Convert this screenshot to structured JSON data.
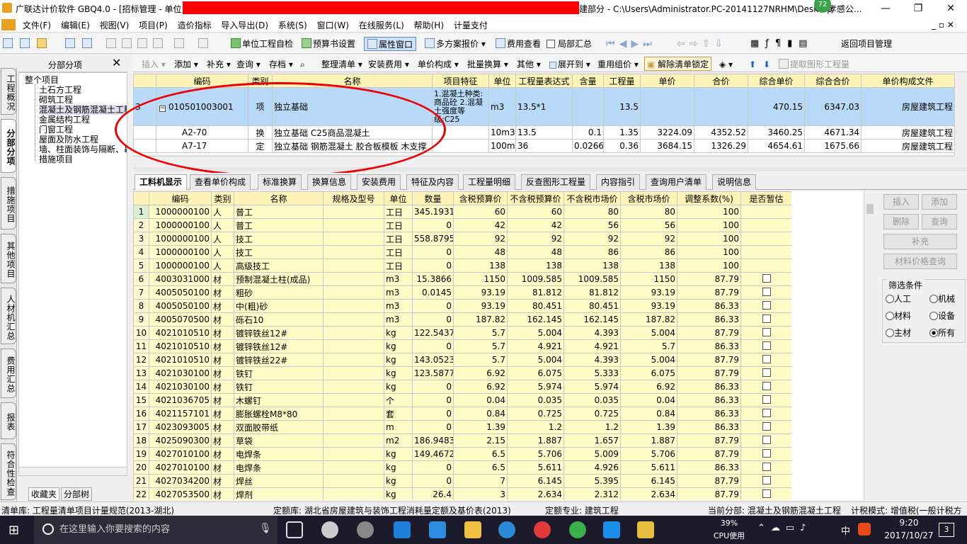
{
  "title": {
    "app": "广联达计价软件 GBQ4.0 - [招标管理 - 单位",
    "right": "建部分 - C:\\Users\\Administrator.PC-20141127NRHM\\Desktop",
    "right2": "孝感公...",
    "badge": "72"
  },
  "menu": [
    "文件(F)",
    "编辑(E)",
    "视图(V)",
    "项目(P)",
    "造价指标",
    "导入导出(D)",
    "系统(S)",
    "窗口(W)",
    "在线服务(L)",
    "帮助(H)",
    "计量支付"
  ],
  "toolbar1": [
    "单位工程自检",
    "预算书设置",
    "属性窗口",
    "多方案报价",
    "费用查看",
    "局部汇总",
    "返回项目管理"
  ],
  "toolbar2": [
    "插入",
    "添加",
    "补充",
    "查询",
    "存档",
    "整理清单",
    "安装费用",
    "单价构成",
    "批量换算",
    "其他",
    "展开到",
    "重用组价",
    "解除清单锁定",
    "提取图形工程量"
  ],
  "left_tabs": [
    "工程概况",
    "分部分项",
    "措施项目",
    "其他项目",
    "人材机汇总",
    "费用汇总",
    "报表",
    "符合性检查"
  ],
  "tree": {
    "header": "分部分项",
    "items": [
      "整个项目",
      "土石方工程",
      "砌筑工程",
      "混凝土及钢筋混凝土工程",
      "金属结构工程",
      "门窗工程",
      "屋面及防水工程",
      "墙、柱面装饰与隔断、幕",
      "措施项目"
    ],
    "bottom_tabs": [
      "收藏夹",
      "分部树"
    ]
  },
  "upper_grid": {
    "headers": [
      "编码",
      "类别",
      "名称",
      "项目特征",
      "单位",
      "工程量表达式",
      "含量",
      "工程量",
      "单价",
      "合价",
      "综合单价",
      "综合合价",
      "单价构成文件"
    ],
    "rows": [
      {
        "rn": "3",
        "code": "010501003001",
        "type": "项",
        "name": "独立基础",
        "feature": "1.混凝土种类:商品砼 2.混凝土强度等级:C25",
        "unit": "m3",
        "expr": "13.5*1",
        "content": "",
        "qty": "13.5",
        "price": "",
        "total": "",
        "uprice": "470.15",
        "utotal": "6347.03",
        "file": "房屋建筑工程"
      },
      {
        "rn": "",
        "code": "A2-70",
        "type": "换",
        "name": "独立基础 C25商品混凝土",
        "feature": "",
        "unit": "10m3",
        "expr": "13.5",
        "content": "0.1",
        "qty": "1.35",
        "price": "3224.09",
        "total": "4352.52",
        "uprice": "3460.25",
        "utotal": "4671.34",
        "file": "房屋建筑工程"
      },
      {
        "rn": "",
        "code": "A7-17",
        "type": "定",
        "name": "独立基础 钢筋混凝土 胶合板模板 木支撑",
        "feature": "",
        "unit": "100m2",
        "expr": "36",
        "content": "0.0266",
        "qty": "0.36",
        "price": "3684.15",
        "total": "1326.29",
        "uprice": "4654.61",
        "utotal": "1675.66",
        "file": "房屋建筑工程"
      }
    ]
  },
  "mid_tabs": [
    "工料机显示",
    "查看单价构成",
    "标准换算",
    "换算信息",
    "安装费用",
    "特征及内容",
    "工程量明细",
    "反查图形工程量",
    "内容指引",
    "查询用户清单",
    "说明信息"
  ],
  "lower_grid": {
    "headers": [
      "编码",
      "类别",
      "名称",
      "规格及型号",
      "单位",
      "数量",
      "含税预算价",
      "不含税预算价",
      "不含税市场价",
      "含税市场价",
      "调整系数(%)",
      "是否暂估"
    ],
    "rows": [
      [
        "1",
        "1000000100",
        "人",
        "普工",
        "",
        "工日",
        "345.1931",
        "60",
        "60",
        "80",
        "80",
        "100",
        ""
      ],
      [
        "2",
        "1000000100",
        "人",
        "普工",
        "",
        "工日",
        "0",
        "42",
        "42",
        "56",
        "56",
        "100",
        ""
      ],
      [
        "3",
        "1000000100",
        "人",
        "技工",
        "",
        "工日",
        "558.8795",
        "92",
        "92",
        "92",
        "92",
        "100",
        ""
      ],
      [
        "4",
        "1000000100",
        "人",
        "技工",
        "",
        "工日",
        "0",
        "48",
        "48",
        "86",
        "86",
        "100",
        ""
      ],
      [
        "5",
        "1000000100",
        "人",
        "高级技工",
        "",
        "工日",
        "0",
        "138",
        "138",
        "138",
        "138",
        "100",
        ""
      ],
      [
        "6",
        "4003031000",
        "材",
        "预制混凝土柱(成品)",
        "",
        "m3",
        "15.3866",
        "1150",
        "1009.585",
        "1009.585",
        "1150",
        "87.79",
        "cb"
      ],
      [
        "7",
        "4005050100",
        "材",
        "粗砂",
        "",
        "m3",
        "0.0145",
        "93.19",
        "81.812",
        "81.812",
        "93.19",
        "87.79",
        "cb"
      ],
      [
        "8",
        "4005050100",
        "材",
        "中(粗)砂",
        "",
        "m3",
        "0",
        "93.19",
        "80.451",
        "80.451",
        "93.19",
        "86.33",
        "cb"
      ],
      [
        "9",
        "4005070500",
        "材",
        "砾石10",
        "",
        "m3",
        "0",
        "187.82",
        "162.145",
        "162.145",
        "187.82",
        "86.33",
        "cb"
      ],
      [
        "10",
        "4021010510",
        "材",
        "镀锌铁丝12#",
        "",
        "kg",
        "122.5437",
        "5.7",
        "5.004",
        "4.393",
        "5.004",
        "87.79",
        "cb"
      ],
      [
        "11",
        "4021010510",
        "材",
        "镀锌铁丝12#",
        "",
        "kg",
        "0",
        "5.7",
        "4.921",
        "4.921",
        "5.7",
        "86.33",
        "cb"
      ],
      [
        "12",
        "4021010510",
        "材",
        "镀锌铁丝22#",
        "",
        "kg",
        "143.0523",
        "5.7",
        "5.004",
        "4.393",
        "5.004",
        "87.79",
        "cb"
      ],
      [
        "13",
        "4021030100",
        "材",
        "铁钉",
        "",
        "kg",
        "123.5877",
        "6.92",
        "6.075",
        "5.333",
        "6.075",
        "87.79",
        "cb"
      ],
      [
        "14",
        "4021030100",
        "材",
        "铁钉",
        "",
        "kg",
        "0",
        "6.92",
        "5.974",
        "5.974",
        "6.92",
        "86.33",
        "cb"
      ],
      [
        "15",
        "4021036705",
        "材",
        "木螺钉",
        "",
        "个",
        "0",
        "0.04",
        "0.035",
        "0.035",
        "0.04",
        "86.33",
        "cb"
      ],
      [
        "16",
        "4021157101",
        "材",
        "膨胀螺栓M8*80",
        "",
        "套",
        "0",
        "0.84",
        "0.725",
        "0.725",
        "0.84",
        "86.33",
        "cb"
      ],
      [
        "17",
        "4023093005",
        "材",
        "双面胶带纸",
        "",
        "m",
        "0",
        "1.39",
        "1.2",
        "1.2",
        "1.39",
        "86.33",
        "cb"
      ],
      [
        "18",
        "4025090300",
        "材",
        "草袋",
        "",
        "m2",
        "186.9483",
        "2.15",
        "1.887",
        "1.657",
        "1.887",
        "87.79",
        "cb"
      ],
      [
        "19",
        "4027010100",
        "材",
        "电焊条",
        "",
        "kg",
        "149.4672",
        "6.5",
        "5.706",
        "5.009",
        "5.706",
        "87.79",
        "cb"
      ],
      [
        "20",
        "4027010100",
        "材",
        "电焊条",
        "",
        "kg",
        "0",
        "6.5",
        "5.611",
        "4.926",
        "5.611",
        "86.33",
        "cb"
      ],
      [
        "21",
        "4027034200",
        "材",
        "焊丝",
        "",
        "kg",
        "0",
        "7",
        "6.145",
        "5.395",
        "6.145",
        "87.79",
        "cb"
      ],
      [
        "22",
        "4027053500",
        "材",
        "焊剂",
        "",
        "kg",
        "26.4",
        "3",
        "2.634",
        "2.312",
        "2.634",
        "87.79",
        "cb"
      ]
    ]
  },
  "right_panel": {
    "buttons": [
      "插入",
      "添加",
      "删除",
      "查询",
      "补充",
      "材料价格查询"
    ],
    "filter_title": "筛选条件",
    "filters": [
      "人工",
      "机械",
      "材料",
      "设备",
      "主材",
      "所有"
    ]
  },
  "status": {
    "s1": "清单库: 工程量清单项目计量规范(2013-湖北)",
    "s2": "定额库: 湖北省房屋建筑与装饰工程消耗量定额及基价表(2013)",
    "s3": "定额专业: 建筑工程",
    "s4": "当前分部: 混凝土及钢筋混凝土工程",
    "s5": "计税模式: 增值税(一般计税方"
  },
  "taskbar": {
    "search_placeholder": "在这里输入你要搜索的内容",
    "cpu": "39%",
    "cpu_label": "CPU使用",
    "time": "9:20",
    "date": "2017/10/27",
    "lang": "中",
    "notif": "3"
  }
}
